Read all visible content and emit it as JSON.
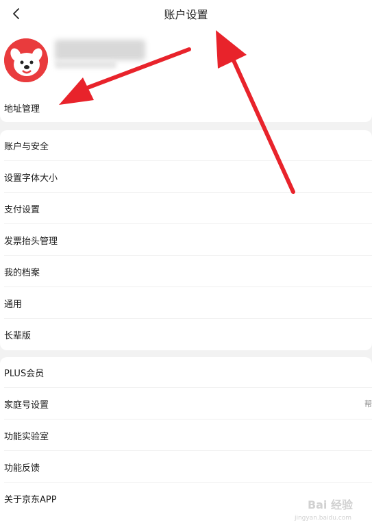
{
  "header": {
    "title": "账户设置"
  },
  "profile": {
    "address_label": "地址管理"
  },
  "group2": {
    "items": [
      {
        "label": "账户与安全"
      },
      {
        "label": "设置字体大小"
      },
      {
        "label": "支付设置"
      },
      {
        "label": "发票抬头管理"
      },
      {
        "label": "我的档案"
      },
      {
        "label": "通用"
      },
      {
        "label": "长辈版"
      }
    ]
  },
  "group3": {
    "items": [
      {
        "label": "PLUS会员"
      },
      {
        "label": "家庭号设置",
        "right_text": "帮"
      },
      {
        "label": "功能实验室"
      },
      {
        "label": "功能反馈"
      },
      {
        "label": "关于京东APP"
      }
    ]
  },
  "watermark": {
    "text": "Bai 经验",
    "sub": "jingyan.baidu.com"
  },
  "colors": {
    "accent": "#e93b3d",
    "annotation_arrow": "#e8232b"
  },
  "icons": {
    "back": "chevron-left-icon",
    "avatar": "jd-dog-mascot"
  }
}
